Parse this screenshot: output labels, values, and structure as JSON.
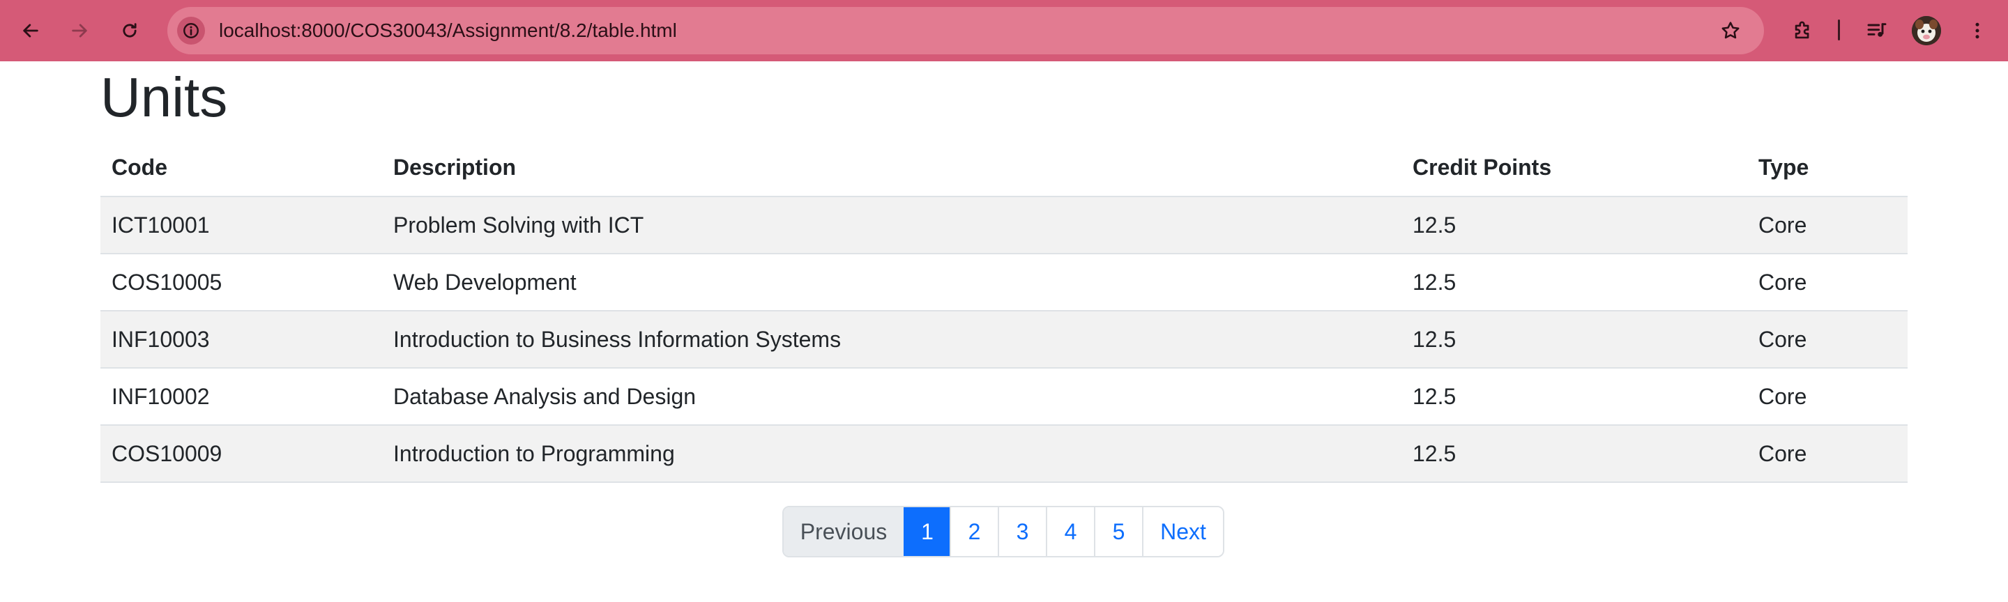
{
  "browser": {
    "url": "localhost:8000/COS30043/Assignment/8.2/table.html",
    "toolbar_color": "#d55a77",
    "omnibox_color": "#e27b91"
  },
  "page": {
    "title": "Units"
  },
  "table": {
    "headers": [
      "Code",
      "Description",
      "Credit Points",
      "Type"
    ],
    "rows": [
      [
        "ICT10001",
        "Problem Solving with ICT",
        "12.5",
        "Core"
      ],
      [
        "COS10005",
        "Web Development",
        "12.5",
        "Core"
      ],
      [
        "INF10003",
        "Introduction to Business Information Systems",
        "12.5",
        "Core"
      ],
      [
        "INF10002",
        "Database Analysis and Design",
        "12.5",
        "Core"
      ],
      [
        "COS10009",
        "Introduction to Programming",
        "12.5",
        "Core"
      ]
    ],
    "stripe_color": "#f2f2f2"
  },
  "pagination": {
    "previous": "Previous",
    "pages": [
      "1",
      "2",
      "3",
      "4",
      "5"
    ],
    "current": "1",
    "next": "Next",
    "accent": "#0d6efd"
  }
}
